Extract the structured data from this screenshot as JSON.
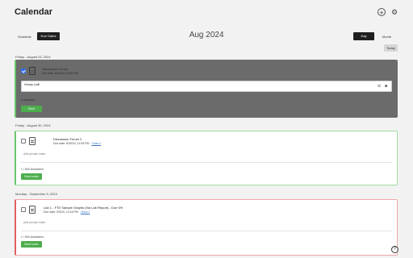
{
  "header": {
    "title": "Calendar",
    "add_icon": "add-circle-icon",
    "settings_icon": "gear-icon"
  },
  "toolbar": {
    "schedule_label": "Schedule",
    "due_dates_label": "Due Dates",
    "month_label": "Aug 2024",
    "day_label": "Day",
    "month_view_label": "Month",
    "today_label": "Today"
  },
  "days": [
    {
      "heading": "Friday - August 23, 2024",
      "item": {
        "title": "Discussion Forum",
        "due": "Due date: 8/23/24, 11:59 PM",
        "link": "",
        "checked": true,
        "reply_value": "Howdy, y'all!",
        "comments": "1 comment",
        "send_label": "Send"
      }
    },
    {
      "heading": "Friday - August 30, 2024",
      "item": {
        "title": "Discussion Forum 2",
        "due": "Due date: 8/30/24, 11:59 PM",
        "link": "Class 2",
        "checked": false,
        "reply_placeholder": "Add private notes",
        "comments": "1 / 500 characters",
        "send_label": "Send notes"
      }
    },
    {
      "heading": "Monday - September 9, 2024",
      "item": {
        "title": "Lab 1 - FTE Sample Graphs (Via Lab Report) - Due 9/9",
        "due": "Due date: 9/9/24, 12:15 PM",
        "link": "Class 2",
        "checked": false,
        "reply_placeholder": "Add private notes",
        "comments": "1 / 500 characters",
        "send_label": "Send notes"
      }
    }
  ],
  "help_icon": "help-circle-icon",
  "colors": {
    "accent_green": "#4cae4c",
    "border_green": "#6cc56c",
    "border_red": "#e06060",
    "dark_button": "#1f1f1f"
  }
}
